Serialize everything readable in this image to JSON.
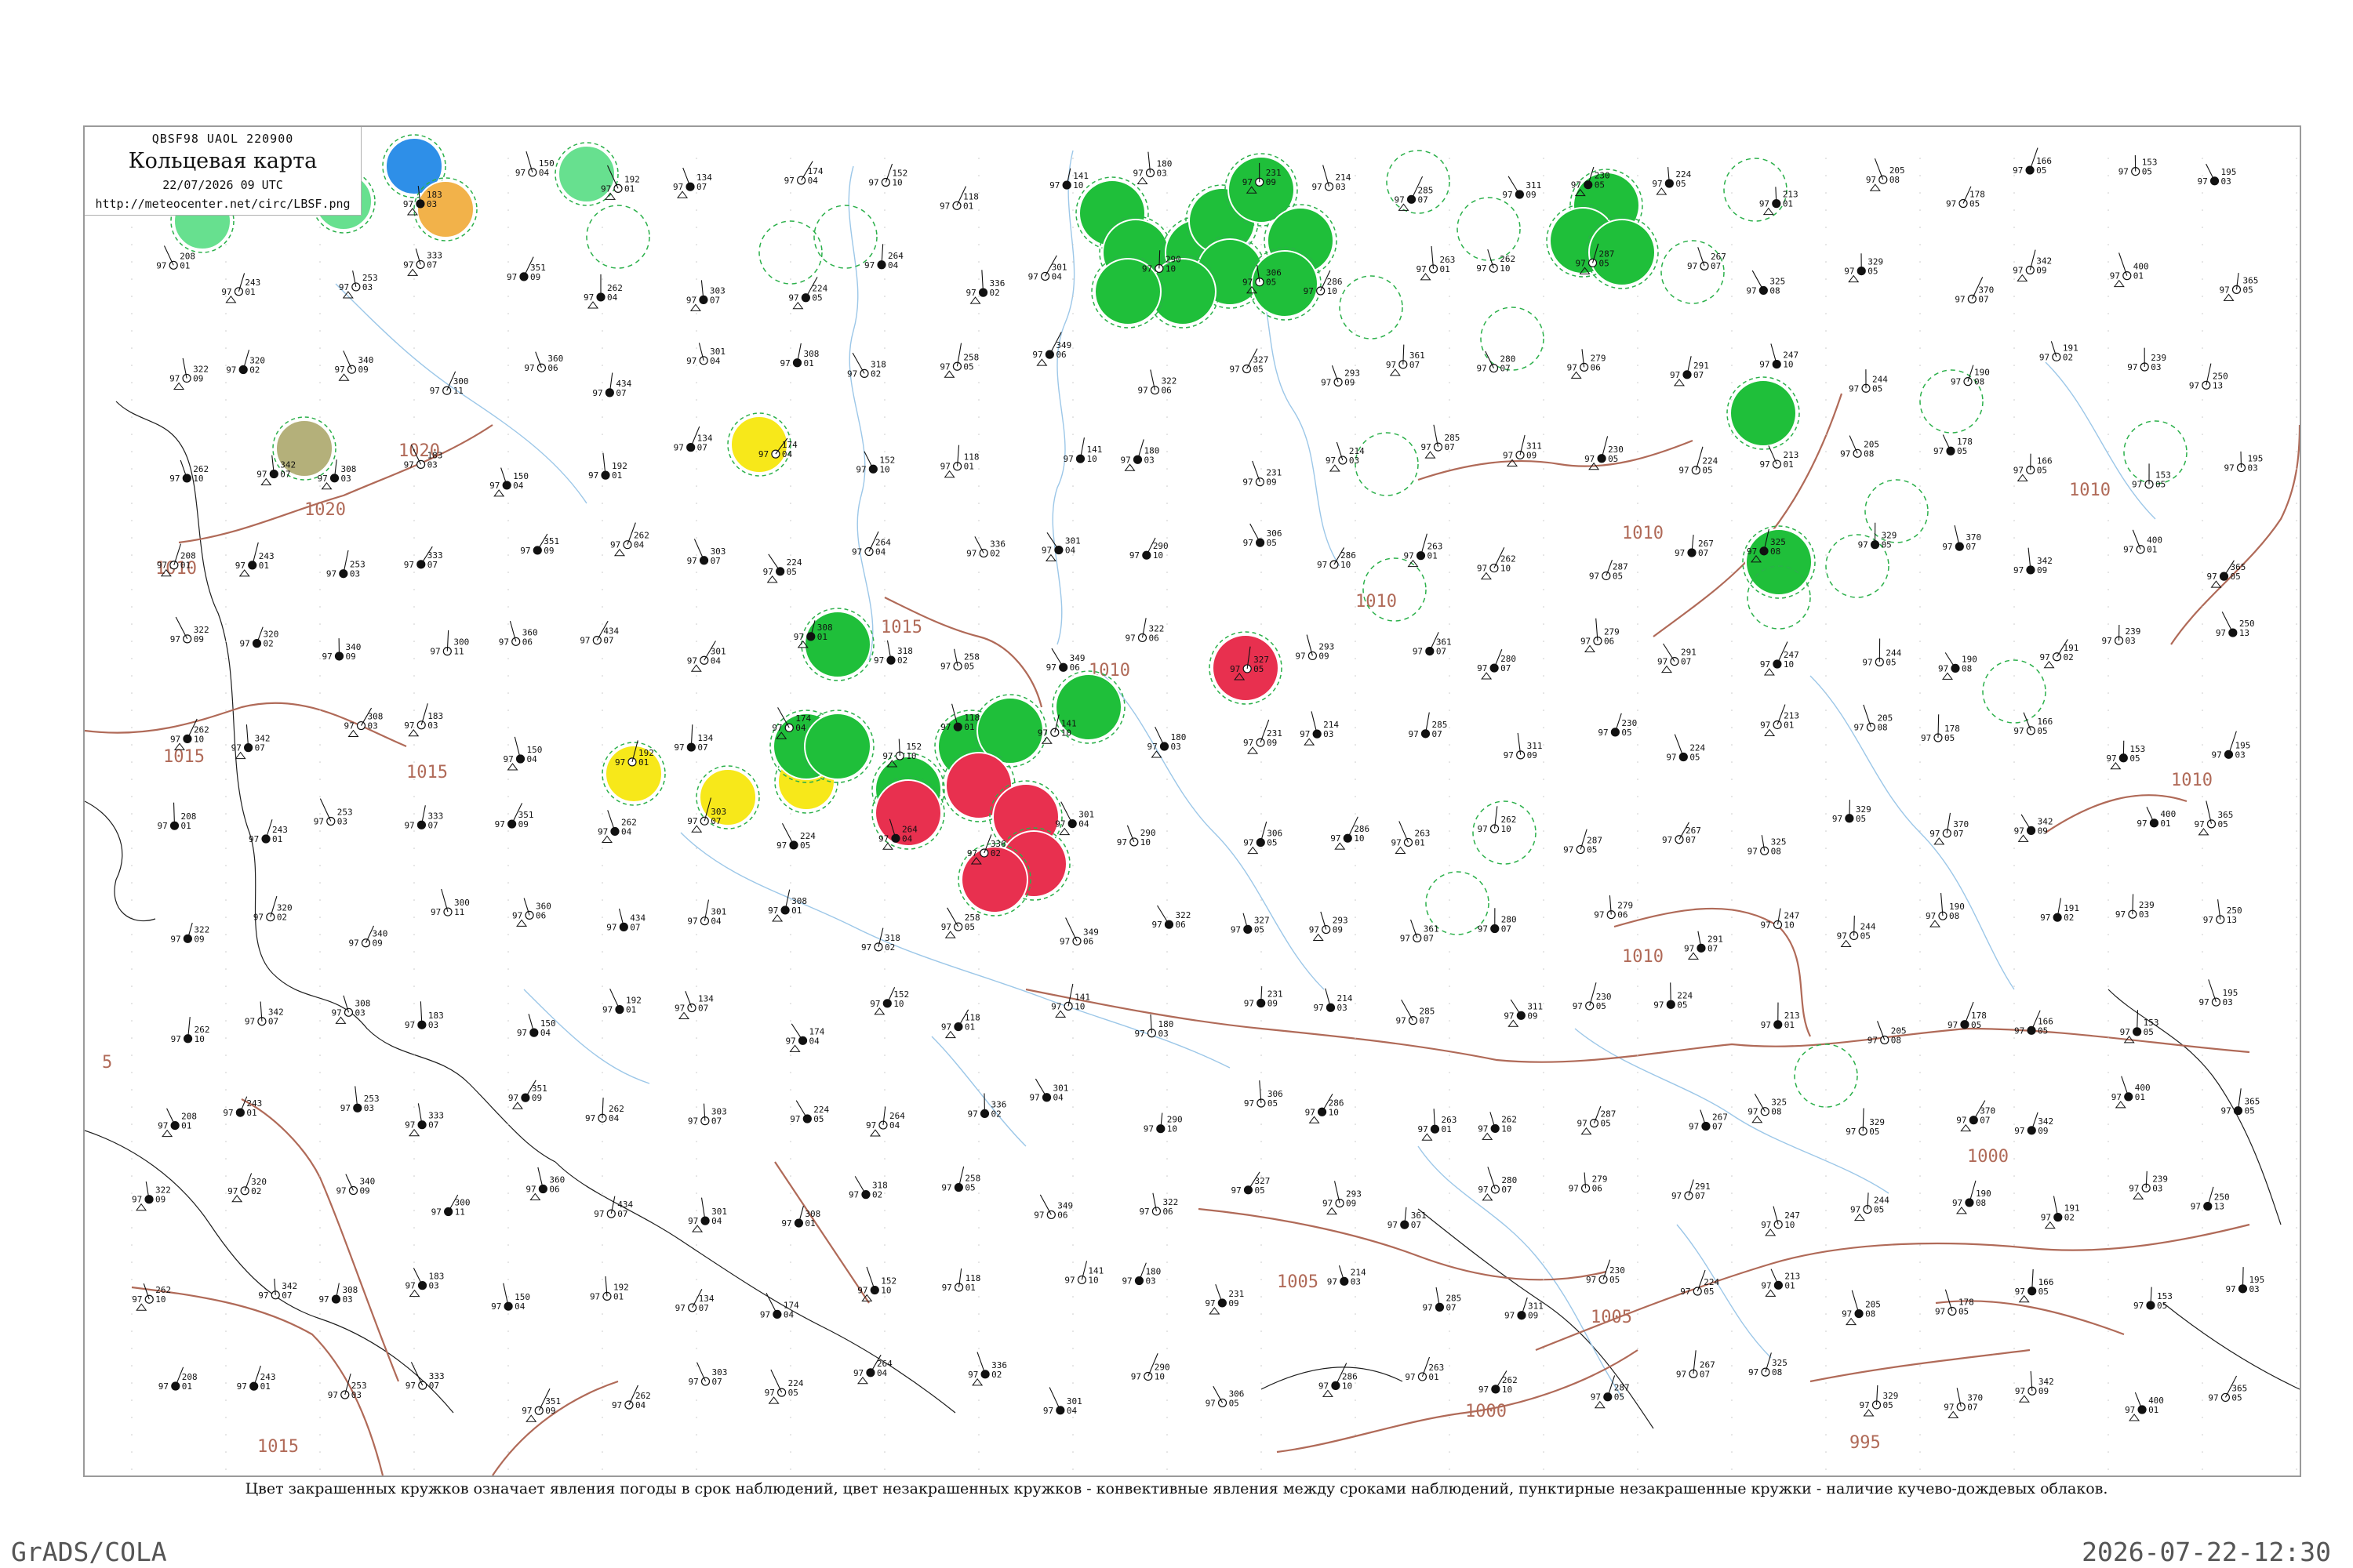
{
  "header": {
    "code": "QBSF98  UAOL  220900",
    "title": "Кольцевая карта",
    "datetime": "22/07/2026 09 UTC",
    "url": "http://meteocenter.net/circ/LBSF.png"
  },
  "legend_note": "Цвет закрашенных кружков означает явления погоды в срок наблюдений, цвет незакрашенных кружков - конвективные явления между сроками наблюдений, пунктирные незакрашенные кружки - наличие кучево-дождевых облаков.",
  "footer": {
    "left": "GrADS/COLA",
    "right": "2026-07-22-12:30"
  },
  "colors": {
    "isobar": "#b06a58",
    "river": "#9cc7e8",
    "rain": "#1fbf3a",
    "thunder": "#e8304f",
    "shower": "#f7e81a",
    "snow": "#2e8fe8",
    "fog": "#f2b24a",
    "haze": "#b4b07a",
    "drizzle": "#67e08f",
    "cb_ring": "#2bb04a"
  },
  "isobar_labels": [
    "1010",
    "1020",
    "1020",
    "1015",
    "1015",
    "1010",
    "1015",
    "1010",
    "1010",
    "1010",
    "1010",
    "1010",
    "1005",
    "1005",
    "1000",
    "1000",
    "995",
    "1015",
    "5"
  ],
  "weather_markers": [
    {
      "type": "snow"
    },
    {
      "type": "fog"
    },
    {
      "type": "drizzle"
    },
    {
      "type": "drizzle"
    },
    {
      "type": "drizzle"
    },
    {
      "type": "haze"
    },
    {
      "type": "shower"
    },
    {
      "type": "shower"
    },
    {
      "type": "shower"
    },
    {
      "type": "shower"
    },
    {
      "type": "rain"
    },
    {
      "type": "rain"
    },
    {
      "type": "rain"
    },
    {
      "type": "rain"
    },
    {
      "type": "rain"
    },
    {
      "type": "rain"
    },
    {
      "type": "rain"
    },
    {
      "type": "rain"
    },
    {
      "type": "rain"
    },
    {
      "type": "rain"
    },
    {
      "type": "rain"
    },
    {
      "type": "rain"
    },
    {
      "type": "rain"
    },
    {
      "type": "rain"
    },
    {
      "type": "rain"
    },
    {
      "type": "rain"
    },
    {
      "type": "rain"
    },
    {
      "type": "rain"
    },
    {
      "type": "rain"
    },
    {
      "type": "rain"
    },
    {
      "type": "rain"
    },
    {
      "type": "rain"
    },
    {
      "type": "thunder"
    },
    {
      "type": "thunder"
    },
    {
      "type": "thunder"
    },
    {
      "type": "thunder"
    },
    {
      "type": "thunder"
    },
    {
      "type": "thunder"
    }
  ],
  "station_samples": [
    {
      "p": "183",
      "t": "97",
      "d": "03"
    },
    {
      "p": "150",
      "t": "97",
      "d": "04"
    },
    {
      "p": "192",
      "t": "97",
      "d": "01"
    },
    {
      "p": "134",
      "t": "97",
      "d": "07"
    },
    {
      "p": "174",
      "t": "97",
      "d": "04"
    },
    {
      "p": "152",
      "t": "97",
      "d": "10"
    },
    {
      "p": "118",
      "t": "97",
      "d": "01"
    },
    {
      "p": "141",
      "t": "97",
      "d": "10"
    },
    {
      "p": "180",
      "t": "97",
      "d": "03"
    },
    {
      "p": "231",
      "t": "97",
      "d": "09"
    },
    {
      "p": "214",
      "t": "97",
      "d": "03"
    },
    {
      "p": "285",
      "t": "97",
      "d": "07"
    },
    {
      "p": "311",
      "t": "97",
      "d": "09"
    },
    {
      "p": "230",
      "t": "97",
      "d": "05"
    },
    {
      "p": "224",
      "t": "97",
      "d": "05"
    },
    {
      "p": "213",
      "t": "97",
      "d": "01"
    },
    {
      "p": "205",
      "t": "97",
      "d": "08"
    },
    {
      "p": "178",
      "t": "97",
      "d": "05"
    },
    {
      "p": "166",
      "t": "97",
      "d": "05"
    },
    {
      "p": "153",
      "t": "97",
      "d": "05"
    },
    {
      "p": "195",
      "t": "97",
      "d": "03"
    },
    {
      "p": "208",
      "t": "97",
      "d": "01"
    },
    {
      "p": "243",
      "t": "97",
      "d": "01"
    },
    {
      "p": "253",
      "t": "97",
      "d": "03"
    },
    {
      "p": "333",
      "t": "97",
      "d": "07"
    },
    {
      "p": "351",
      "t": "97",
      "d": "09"
    },
    {
      "p": "262",
      "t": "97",
      "d": "04"
    },
    {
      "p": "303",
      "t": "97",
      "d": "07"
    },
    {
      "p": "224",
      "t": "97",
      "d": "05"
    },
    {
      "p": "264",
      "t": "97",
      "d": "04"
    },
    {
      "p": "336",
      "t": "97",
      "d": "02"
    },
    {
      "p": "301",
      "t": "97",
      "d": "04"
    },
    {
      "p": "290",
      "t": "97",
      "d": "10"
    },
    {
      "p": "306",
      "t": "97",
      "d": "05"
    },
    {
      "p": "286",
      "t": "97",
      "d": "10"
    },
    {
      "p": "263",
      "t": "97",
      "d": "01"
    },
    {
      "p": "262",
      "t": "97",
      "d": "10"
    },
    {
      "p": "287",
      "t": "97",
      "d": "05"
    },
    {
      "p": "267",
      "t": "97",
      "d": "07"
    },
    {
      "p": "325",
      "t": "97",
      "d": "08"
    },
    {
      "p": "329",
      "t": "97",
      "d": "05"
    },
    {
      "p": "370",
      "t": "97",
      "d": "07"
    },
    {
      "p": "342",
      "t": "97",
      "d": "09"
    },
    {
      "p": "400",
      "t": "97",
      "d": "01"
    },
    {
      "p": "365",
      "t": "97",
      "d": "05"
    },
    {
      "p": "322",
      "t": "97",
      "d": "09"
    },
    {
      "p": "320",
      "t": "97",
      "d": "02"
    },
    {
      "p": "340",
      "t": "97",
      "d": "09"
    },
    {
      "p": "300",
      "t": "97",
      "d": "11"
    },
    {
      "p": "360",
      "t": "97",
      "d": "06"
    },
    {
      "p": "434",
      "t": "97",
      "d": "07"
    },
    {
      "p": "301",
      "t": "97",
      "d": "04"
    },
    {
      "p": "308",
      "t": "97",
      "d": "01"
    },
    {
      "p": "318",
      "t": "97",
      "d": "02"
    },
    {
      "p": "258",
      "t": "97",
      "d": "05"
    },
    {
      "p": "349",
      "t": "97",
      "d": "06"
    },
    {
      "p": "322",
      "t": "97",
      "d": "06"
    },
    {
      "p": "327",
      "t": "97",
      "d": "05"
    },
    {
      "p": "293",
      "t": "97",
      "d": "09"
    },
    {
      "p": "361",
      "t": "97",
      "d": "07"
    },
    {
      "p": "280",
      "t": "97",
      "d": "07"
    },
    {
      "p": "279",
      "t": "97",
      "d": "06"
    },
    {
      "p": "291",
      "t": "97",
      "d": "07"
    },
    {
      "p": "247",
      "t": "97",
      "d": "10"
    },
    {
      "p": "244",
      "t": "97",
      "d": "05"
    },
    {
      "p": "190",
      "t": "97",
      "d": "08"
    },
    {
      "p": "191",
      "t": "97",
      "d": "02"
    },
    {
      "p": "239",
      "t": "97",
      "d": "03"
    },
    {
      "p": "250",
      "t": "97",
      "d": "13"
    },
    {
      "p": "262",
      "t": "97",
      "d": "10"
    },
    {
      "p": "342",
      "t": "97",
      "d": "07"
    },
    {
      "p": "308",
      "t": "97",
      "d": "03"
    }
  ]
}
